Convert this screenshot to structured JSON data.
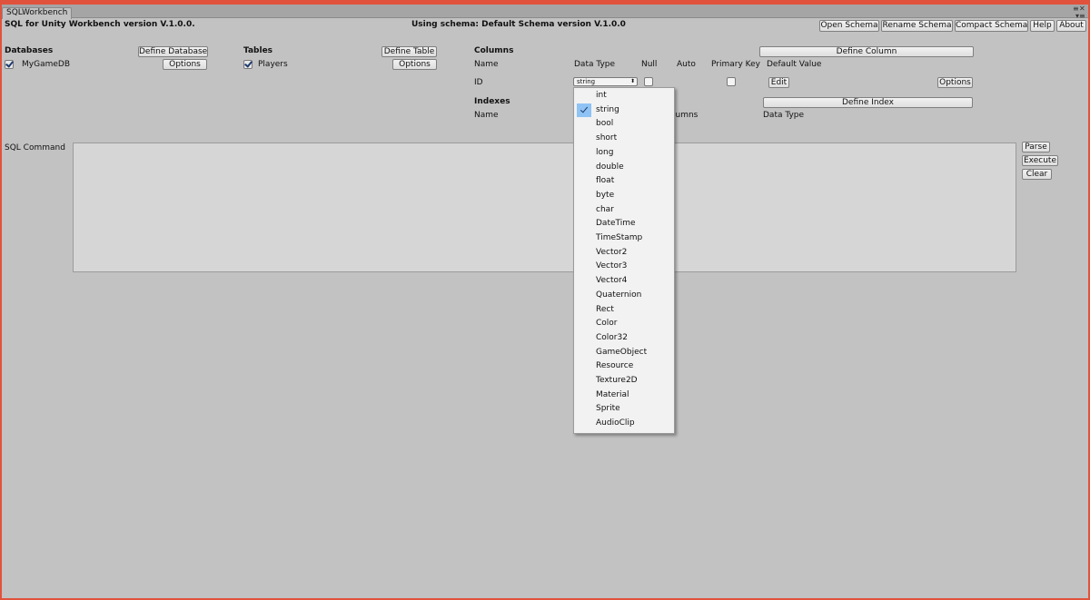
{
  "window": {
    "tab_label": "SQLWorkbench",
    "controls": [
      "≡",
      "▾≡",
      "✕"
    ]
  },
  "header": {
    "app_title": "SQL for Unity Workbench version V.1.0.0.",
    "schema_info": "Using schema: Default Schema version V.1.0.0",
    "buttons": {
      "open_schema": "Open Schema",
      "rename_schema": "Rename Schema",
      "compact_schema": "Compact Schema",
      "help": "Help",
      "about": "About"
    }
  },
  "databases": {
    "heading": "Databases",
    "define_button": "Define Database",
    "options_button": "Options",
    "items": [
      {
        "name": "MyGameDB",
        "checked": true
      }
    ]
  },
  "tables": {
    "heading": "Tables",
    "define_button": "Define Table",
    "options_button": "Options",
    "items": [
      {
        "name": "Players",
        "checked": true
      }
    ]
  },
  "columns": {
    "heading": "Columns",
    "define_button": "Define Column",
    "headers": {
      "name": "Name",
      "data_type": "Data Type",
      "null": "Null",
      "auto": "Auto",
      "primary_key": "Primary Key",
      "default_value": "Default Value"
    },
    "row": {
      "name": "ID",
      "data_type": "string",
      "null_checked": false,
      "primary_key_checked": false,
      "edit_button": "Edit",
      "options_button": "Options"
    }
  },
  "indexes": {
    "heading": "Indexes",
    "define_button": "Define Index",
    "headers": {
      "name": "Name",
      "columns_partial": "lumns",
      "data_type": "Data Type"
    }
  },
  "sql": {
    "label": "SQL Command",
    "text": "",
    "buttons": {
      "parse": "Parse",
      "execute": "Execute",
      "clear": "Clear"
    }
  },
  "dropdown": {
    "selected": "string",
    "options": [
      "int",
      "string",
      "bool",
      "short",
      "long",
      "double",
      "float",
      "byte",
      "char",
      "DateTime",
      "TimeStamp",
      "Vector2",
      "Vector3",
      "Vector4",
      "Quaternion",
      "Rect",
      "Color",
      "Color32",
      "GameObject",
      "Resource",
      "Texture2D",
      "Material",
      "Sprite",
      "AudioClip"
    ]
  },
  "colors": {
    "frame": "#e1523c",
    "background": "#c2c2c2",
    "selection": "#8fc3f5"
  }
}
